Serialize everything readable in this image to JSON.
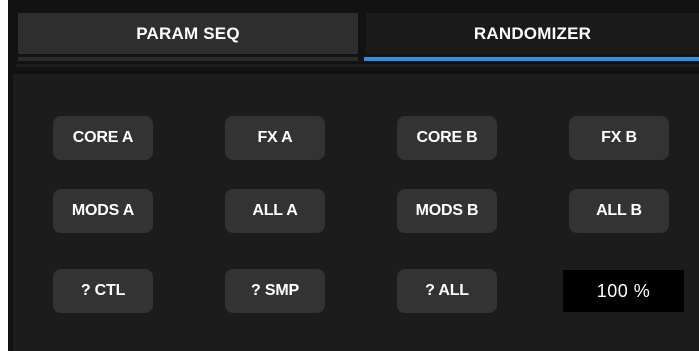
{
  "tabs": [
    {
      "label": "PARAM SEQ",
      "active": false
    },
    {
      "label": "RANDOMIZER",
      "active": true
    }
  ],
  "accent_color": "#2f8fe0",
  "randomizer": {
    "row1": [
      "CORE A",
      "FX A",
      "CORE B",
      "FX B"
    ],
    "row2": [
      "MODS A",
      "ALL A",
      "MODS B",
      "ALL B"
    ],
    "row3": [
      "? CTL",
      "? SMP",
      "? ALL"
    ],
    "amount": "100 %"
  }
}
